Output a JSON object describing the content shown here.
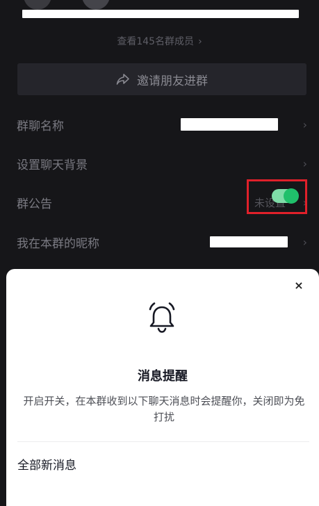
{
  "members": {
    "view_all": "查看145名群成员",
    "arrow": "›"
  },
  "invite": {
    "label": "邀请朋友进群",
    "icon": "share-arrow-icon"
  },
  "settings": {
    "group_name_label": "群聊名称",
    "background_label": "设置聊天背景",
    "notice_label": "群公告",
    "notice_value": "未设置",
    "nickname_label": "我在本群的昵称",
    "chevron": "›"
  },
  "sheet": {
    "close": "×",
    "icon": "bell-icon",
    "title": "消息提醒",
    "description": "开启开关，在本群收到以下聊天消息时会提醒你，关闭即为免打扰",
    "all_messages_label": "全部新消息",
    "all_messages_enabled": true
  },
  "colors": {
    "background": "#161619",
    "sheet": "#ffffff",
    "toggle_on": "#20c06b",
    "highlight": "#e0202a"
  }
}
